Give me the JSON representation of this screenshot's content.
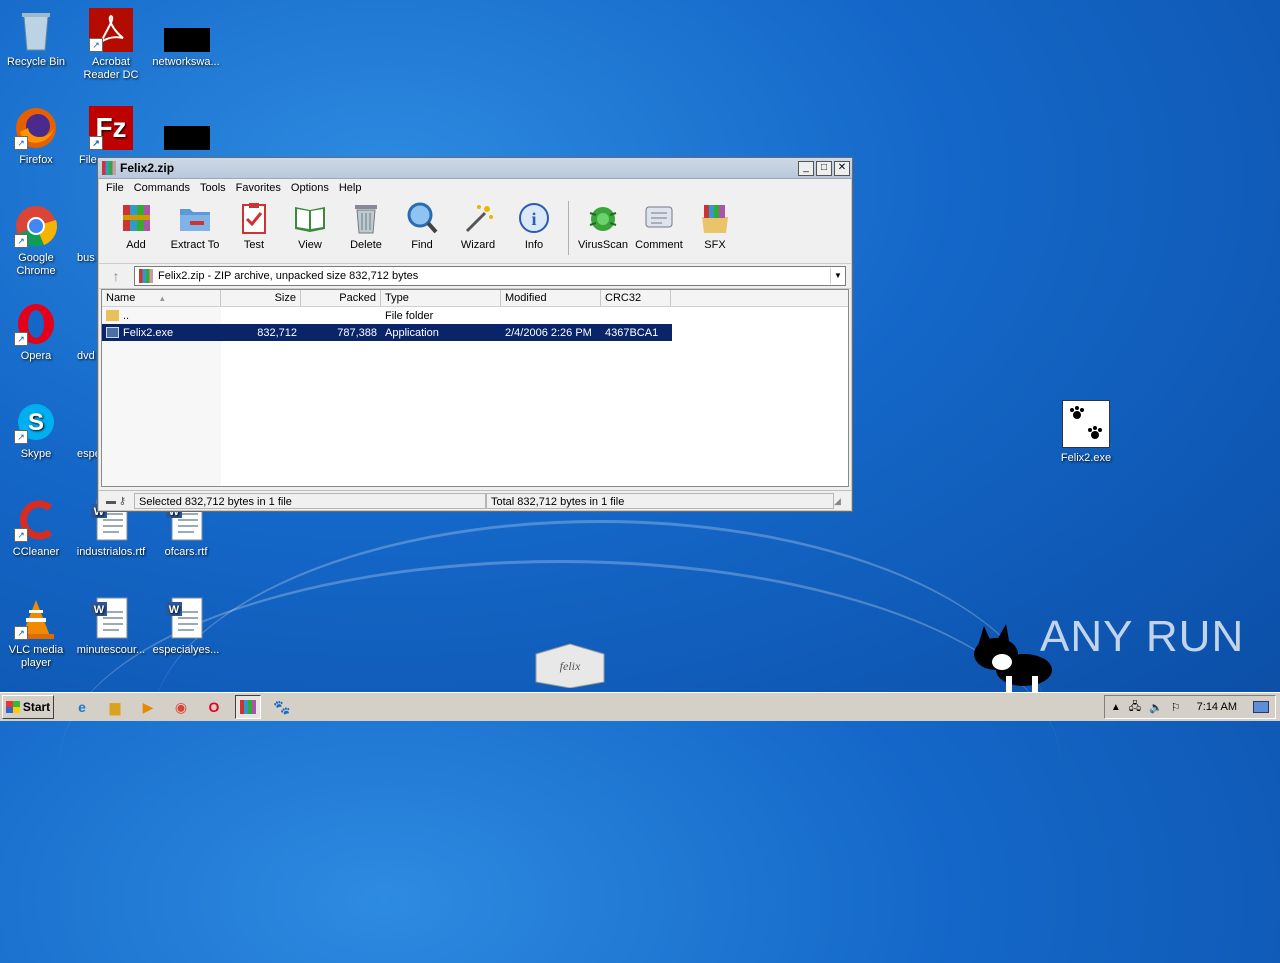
{
  "desktop": {
    "icons": [
      {
        "label": "Recycle Bin"
      },
      {
        "label": "Acrobat\nReader DC"
      },
      {
        "label": "networkswa..."
      },
      {
        "label": "Firefox"
      },
      {
        "label": "File"
      },
      {
        "label": "Google\nChrome"
      },
      {
        "label": "bus"
      },
      {
        "label": "Opera"
      },
      {
        "label": "dvd"
      },
      {
        "label": "Skype"
      },
      {
        "label": "espe"
      },
      {
        "label": "CCleaner"
      },
      {
        "label": "industrialos.rtf"
      },
      {
        "label": "ofcars.rtf"
      },
      {
        "label": "VLC media\nplayer"
      },
      {
        "label": "minutescour..."
      },
      {
        "label": "especialyes..."
      },
      {
        "label": "Felix2.exe"
      }
    ],
    "watermark": "ANY RUN"
  },
  "window": {
    "title": "Felix2.zip",
    "menu": [
      "File",
      "Commands",
      "Tools",
      "Favorites",
      "Options",
      "Help"
    ],
    "toolbar": [
      "Add",
      "Extract To",
      "Test",
      "View",
      "Delete",
      "Find",
      "Wizard",
      "Info",
      "VirusScan",
      "Comment",
      "SFX"
    ],
    "address": "Felix2.zip - ZIP archive, unpacked size 832,712 bytes",
    "columns": [
      "Name",
      "Size",
      "Packed",
      "Type",
      "Modified",
      "CRC32"
    ],
    "rows": [
      {
        "name": "..",
        "size": "",
        "packed": "",
        "type": "File folder",
        "modified": "",
        "crc": ""
      },
      {
        "name": "Felix2.exe",
        "size": "832,712",
        "packed": "787,388",
        "type": "Application",
        "modified": "2/4/2006 2:26 PM",
        "crc": "4367BCA1"
      }
    ],
    "status_left": "Selected 832,712 bytes in 1 file",
    "status_right": "Total 832,712 bytes in 1 file"
  },
  "taskbar": {
    "start": "Start",
    "clock": "7:14 AM"
  },
  "colors": {
    "desktop": "#1467c8",
    "selection": "#0a246a",
    "taskbar": "#d4d0c8"
  }
}
